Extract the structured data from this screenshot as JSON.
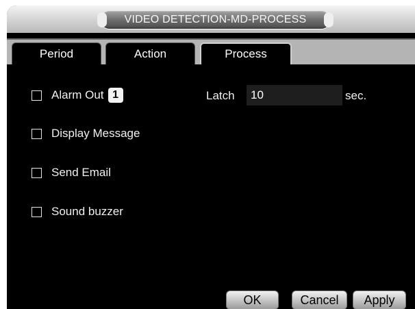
{
  "window": {
    "title": "VIDEO DETECTION-MD-PROCESS"
  },
  "tabs": [
    {
      "label": "Period",
      "active": false
    },
    {
      "label": "Action",
      "active": false
    },
    {
      "label": "Process",
      "active": true
    }
  ],
  "process": {
    "alarm_out": {
      "label": "Alarm Out",
      "checked": false,
      "channel": "1"
    },
    "latch": {
      "label": "Latch",
      "value": "10",
      "unit": "sec."
    },
    "display_message": {
      "label": "Display Message",
      "checked": false
    },
    "send_email": {
      "label": "Send Email",
      "checked": false
    },
    "sound_buzzer": {
      "label": "Sound buzzer",
      "checked": false
    }
  },
  "buttons": {
    "ok": "OK",
    "cancel": "Cancel",
    "apply": "Apply"
  },
  "colors": {
    "background": "#000000",
    "tab_strip": "#b4b4b4",
    "text": "#f0f0f0"
  }
}
